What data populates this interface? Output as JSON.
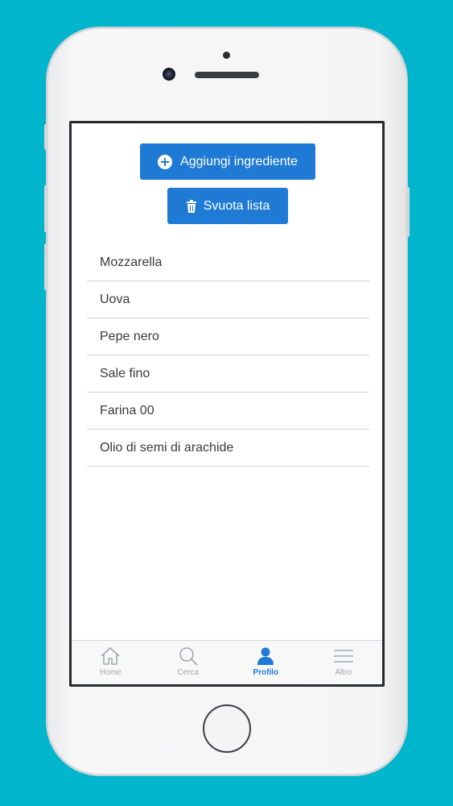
{
  "actions": {
    "add_label": "Aggiungi ingrediente",
    "clear_label": "Svuota lista"
  },
  "ingredients": [
    "Mozzarella",
    "Uova",
    "Pepe nero",
    "Sale fino",
    "Farina 00",
    "Olio di semi di arachide"
  ],
  "tabbar": {
    "items": [
      {
        "label": "Home",
        "icon": "home-icon"
      },
      {
        "label": "Cerca",
        "icon": "search-icon"
      },
      {
        "label": "Profilo",
        "icon": "user-icon",
        "active": true
      },
      {
        "label": "Altro",
        "icon": "menu-icon"
      }
    ]
  },
  "colors": {
    "background": "#00b5cc",
    "accent": "#1f7ad6",
    "tab_inactive": "#a4a7ad"
  }
}
